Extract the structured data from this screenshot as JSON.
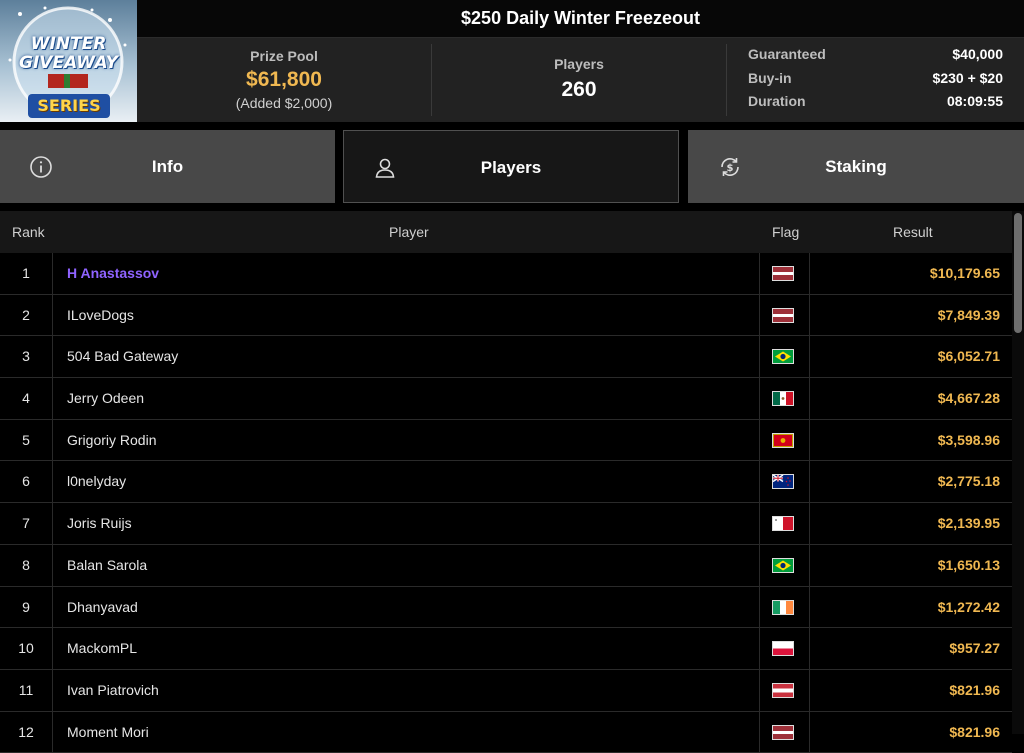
{
  "header": {
    "title": "$250 Daily Winter Freezeout",
    "logo": {
      "line1": "WINTER",
      "line2": "GIVEAWAY",
      "line3": "SERIES"
    }
  },
  "summary": {
    "prize_pool_label": "Prize Pool",
    "prize_pool_value": "$61,800",
    "prize_pool_added": "(Added $2,000)",
    "players_label": "Players",
    "players_value": "260",
    "details": [
      {
        "label": "Guaranteed",
        "value": "$40,000"
      },
      {
        "label": "Buy-in",
        "value": "$230 + $20"
      },
      {
        "label": "Duration",
        "value": "08:09:55"
      }
    ]
  },
  "tabs": [
    {
      "label": "Info",
      "icon": "info-icon"
    },
    {
      "label": "Players",
      "icon": "user-icon",
      "active": true
    },
    {
      "label": "Staking",
      "icon": "dollar-refresh-icon"
    }
  ],
  "table": {
    "columns": {
      "rank": "Rank",
      "player": "Player",
      "flag": "Flag",
      "result": "Result"
    },
    "rows": [
      {
        "rank": "1",
        "player": "H Anastassov",
        "flag": "latvia",
        "result": "$10,179.65",
        "highlight": true
      },
      {
        "rank": "2",
        "player": "ILoveDogs",
        "flag": "latvia",
        "result": "$7,849.39"
      },
      {
        "rank": "3",
        "player": "504 Bad Gateway",
        "flag": "brazil",
        "result": "$6,052.71"
      },
      {
        "rank": "4",
        "player": "Jerry Odeen",
        "flag": "mexico",
        "result": "$4,667.28"
      },
      {
        "rank": "5",
        "player": "Grigoriy Rodin",
        "flag": "montenegro",
        "result": "$3,598.96"
      },
      {
        "rank": "6",
        "player": "l0nelyday",
        "flag": "new-zealand",
        "result": "$2,775.18"
      },
      {
        "rank": "7",
        "player": "Joris Ruijs",
        "flag": "malta",
        "result": "$2,139.95"
      },
      {
        "rank": "8",
        "player": "Balan Sarola",
        "flag": "brazil",
        "result": "$1,650.13"
      },
      {
        "rank": "9",
        "player": "Dhanyavad",
        "flag": "ireland",
        "result": "$1,272.42"
      },
      {
        "rank": "10",
        "player": "MackomPL",
        "flag": "poland",
        "result": "$957.27"
      },
      {
        "rank": "11",
        "player": "Ivan Piatrovich",
        "flag": "belarus",
        "result": "$821.96"
      },
      {
        "rank": "12",
        "player": "Moment Mori",
        "flag": "latvia",
        "result": "$821.96"
      }
    ]
  }
}
